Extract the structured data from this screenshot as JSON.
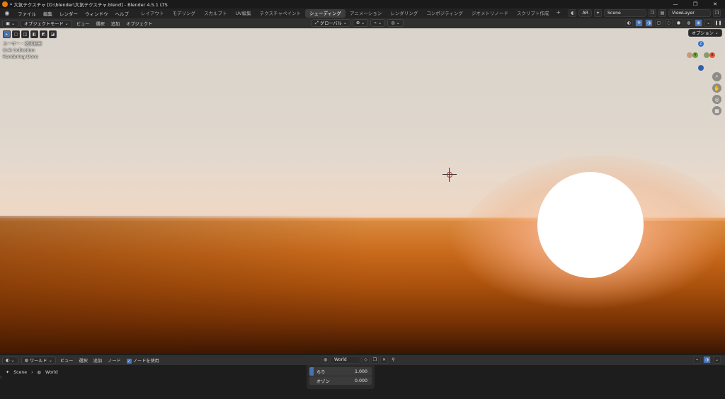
{
  "window": {
    "title": "* 大気テクスチャ [D:\\blender\\大気テクスチャ.blend] - Blender 4.5.1 LTS",
    "controls": [
      "—",
      "❐",
      "✕"
    ]
  },
  "menubar": {
    "menus": [
      "ファイル",
      "編集",
      "レンダー",
      "ウィンドウ",
      "ヘルプ"
    ],
    "workspaces": [
      "レイアウト",
      "モデリング",
      "スカルプト",
      "UV編集",
      "テクスチャペイント",
      "シェーディング",
      "アニメーション",
      "レンダリング",
      "コンポジティング",
      "ジオメトリノード",
      "スクリプト作成"
    ],
    "active_workspace": "シェーディング",
    "add_workspace": "+",
    "ar_label": "AR",
    "scene": "Scene",
    "view_layer": "ViewLayer"
  },
  "viewport_header": {
    "mode": "オブジェクトモード",
    "menus": [
      "ビュー",
      "選択",
      "追加",
      "オブジェクト"
    ],
    "orientation": "グローバル",
    "options": "オプション"
  },
  "viewport": {
    "overlay_line1": "ユーザー・透視投影",
    "overlay_line2": "(14) Collection",
    "overlay_line3": "Rendering Done",
    "gizmo": {
      "z": "Z",
      "y": "Y",
      "x": "X"
    },
    "colors": {
      "sky_top": "#d9d4cc",
      "sun": "#ffffff",
      "sea": "#c86f1e",
      "sea_dark": "#3a1702"
    }
  },
  "node_editor_header": {
    "type": "ワールド",
    "menus": [
      "ビュー",
      "選択",
      "追加",
      "ノード"
    ],
    "use_nodes_label": "ノードを使用",
    "world_name": "World"
  },
  "breadcrumb": {
    "scene": "Scene",
    "world": "World"
  },
  "world_panel": {
    "rows": [
      {
        "label": "ちり",
        "value": "1.000"
      },
      {
        "label": "オゾン",
        "value": "0.000"
      }
    ]
  }
}
